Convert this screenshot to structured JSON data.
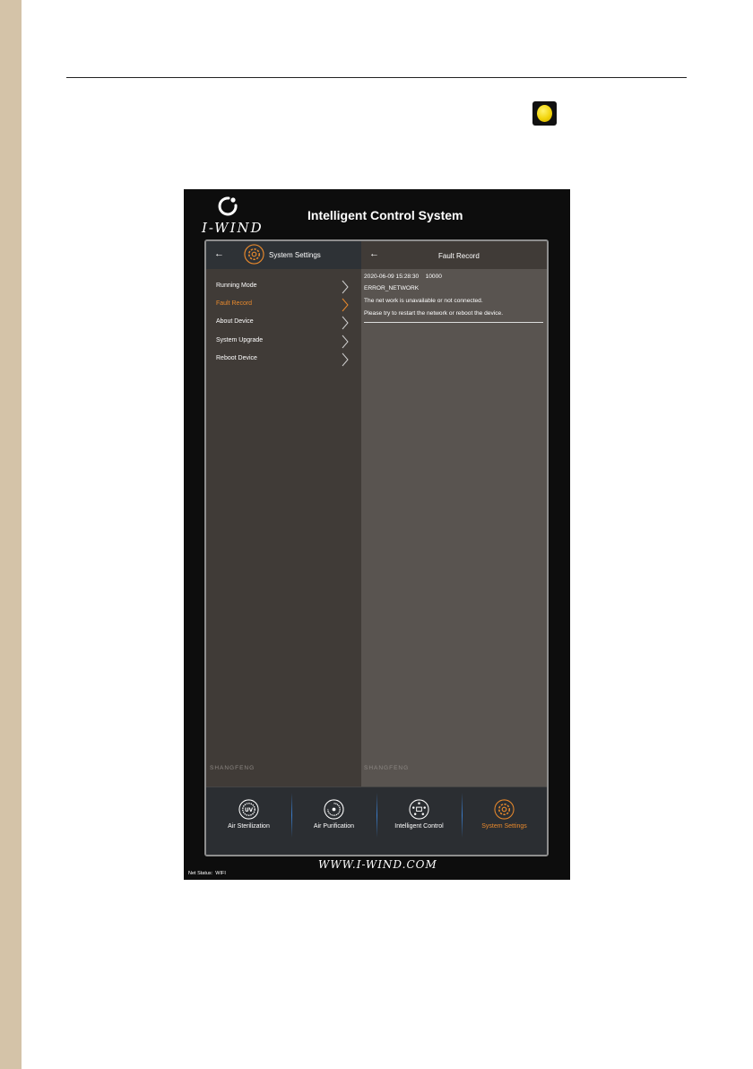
{
  "device": {
    "logo_text": "I-WIND",
    "title": "Intelligent Control System",
    "url": "WWW.I-WIND.COM",
    "net_status_label": "Net Status:",
    "net_status_value": "WIFI"
  },
  "left_panel": {
    "title": "System Settings",
    "brand": "SHANGFENG",
    "active_index": 1,
    "menu": [
      {
        "label": "Running Mode"
      },
      {
        "label": "Fault Record"
      },
      {
        "label": "About Device"
      },
      {
        "label": "System Upgrade"
      },
      {
        "label": "Reboot Device"
      }
    ]
  },
  "right_panel": {
    "title": "Fault Record",
    "brand": "SHANGFENG",
    "record": {
      "timestamp": "2020-06-09 15:28:30",
      "code": "10000",
      "error": "ERROR_NETWORK",
      "line1": "The net work is unavailable or not connected.",
      "line2": "Please try to restart the network or reboot the device."
    }
  },
  "bottom_nav": {
    "active_index": 3,
    "items": [
      {
        "label": "Air Sterilization",
        "icon": "uv-icon"
      },
      {
        "label": "Air Purification",
        "icon": "purification-icon"
      },
      {
        "label": "Intelligent Control",
        "icon": "network-icon"
      },
      {
        "label": "System Settings",
        "icon": "gear-icon"
      }
    ]
  },
  "colors": {
    "accent": "#e8892c",
    "panel_left": "#403b37",
    "panel_right": "#595450",
    "nav_bg": "#2b2e32",
    "side_strip": "#d4c3a8"
  }
}
